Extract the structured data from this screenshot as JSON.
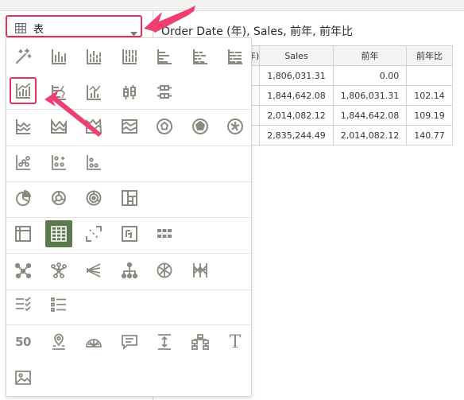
{
  "selector": {
    "label": "表",
    "icon": "table-icon"
  },
  "viz": {
    "title": "Order Date (年), Sales, 前年, 前年比"
  },
  "table": {
    "headers": [
      "年)",
      "Sales",
      "前年",
      "前年比"
    ],
    "rows": [
      [
        "1,806,031.31",
        "0.00",
        ""
      ],
      [
        "1,844,642.08",
        "1,806,031.31",
        "102.14"
      ],
      [
        "2,014,082.12",
        "1,844,642.08",
        "109.19"
      ],
      [
        "2,835,244.49",
        "2,014,082.12",
        "140.77"
      ]
    ]
  },
  "gallery": {
    "rows": [
      [
        "recommended-wand-icon",
        "bar-chart-icon",
        "stacked-bar-icon",
        "stacked-bar-100-icon",
        "horizontal-bar-icon",
        "horizontal-stacked-bar-icon",
        "horizontal-stacked-bar-100-icon"
      ],
      [
        "combo-chart-icon",
        "horizontal-combo-icon",
        "scatter-line-icon",
        "boxplot-icon",
        "horizontal-boxplot-icon"
      ],
      [
        "area-chart-icon",
        "stacked-area-icon",
        "stacked-area-100-icon",
        "waterfall-icon",
        "radar-line-icon",
        "radar-area-icon",
        "radar-bar-icon"
      ],
      [
        "scatter-icon",
        "scatter-matrix-icon",
        "dot-plot-icon"
      ],
      [
        "pie-chart-icon",
        "donut-chart-icon",
        "sunburst-icon",
        "treemap-icon"
      ],
      [
        "pivot-icon",
        "table-icon",
        "heat-matrix-icon",
        "tile-icon",
        "mini-tiles-icon"
      ],
      [
        "network-icon",
        "sankey-icon",
        "chord-icon",
        "tree-diagram-icon",
        "circle-network-icon",
        "parallel-coordinates-icon"
      ],
      [
        "list-check-icon",
        "list-icon"
      ],
      [
        "number-tile-icon",
        "map-pin-icon",
        "map-layer-icon",
        "comment-icon",
        "vertical-spacer-icon",
        "tree-structure-icon",
        "text-icon"
      ],
      [
        "image-icon"
      ]
    ],
    "number_tile_text": "50",
    "text_glyph": "T",
    "selected": "table-icon",
    "highlighted": "combo-chart-icon"
  },
  "colors": {
    "highlight": "#e0325a",
    "selected_bg": "#5b7a4e",
    "icon": "#8c8a80"
  }
}
